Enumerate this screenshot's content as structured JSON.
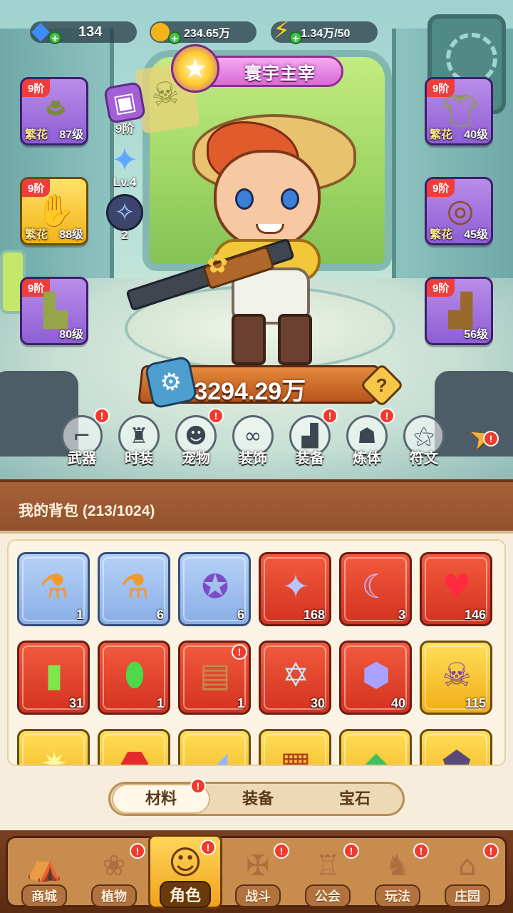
{
  "resources": {
    "gems": {
      "value": "134",
      "icon": "gem-icon"
    },
    "coins": {
      "value": "234.65万",
      "icon": "coin-icon"
    },
    "energy": {
      "value": "1.34万/50",
      "icon": "lightning-icon"
    }
  },
  "title_banner": {
    "text": "寰宇主宰"
  },
  "side_stats": {
    "rank": {
      "label": "9阶",
      "icon": "purple-box-icon"
    },
    "level": {
      "label": "Lv.4",
      "icon": "blue-star-icon"
    },
    "count": {
      "label": "2",
      "icon": "galaxy-orb-icon"
    }
  },
  "equipment": {
    "hat": {
      "rank": "9阶",
      "grade": "繁花",
      "level": "87级",
      "icon": "hat-icon"
    },
    "gloves": {
      "rank": "9阶",
      "grade": "繁花",
      "level": "88级",
      "icon": "gloves-icon"
    },
    "pants": {
      "rank": "9阶",
      "grade": "",
      "level": "80级",
      "icon": "shorts-icon"
    },
    "shirt": {
      "rank": "9阶",
      "grade": "繁花",
      "level": "40级",
      "icon": "shirt-icon"
    },
    "belt": {
      "rank": "9阶",
      "grade": "繁花",
      "level": "45级",
      "icon": "belt-icon"
    },
    "boots": {
      "rank": "9阶",
      "grade": "",
      "level": "56级",
      "icon": "boots-icon"
    }
  },
  "power": {
    "value": "3294.29万",
    "help": "?"
  },
  "functions": [
    {
      "label": "武器",
      "icon": "gun-icon",
      "alert": true
    },
    {
      "label": "时装",
      "icon": "outfit-icon",
      "alert": false
    },
    {
      "label": "宠物",
      "icon": "pet-icon",
      "alert": true
    },
    {
      "label": "装饰",
      "icon": "mask-icon",
      "alert": false
    },
    {
      "label": "装备",
      "icon": "boot-icon",
      "alert": true
    },
    {
      "label": "炼体",
      "icon": "muscle-icon",
      "alert": true
    },
    {
      "label": "符文",
      "icon": "rune-icon",
      "alert": false
    }
  ],
  "bag": {
    "title": "我的背包 (213/1024)",
    "items": [
      {
        "name": "syringe-orange",
        "count": "1",
        "rarity": "blue",
        "icon": "syringe-icon",
        "alert": false
      },
      {
        "name": "syringe-puzzle",
        "count": "6",
        "rarity": "blue",
        "icon": "syringe-icon",
        "alert": false
      },
      {
        "name": "compass-orb",
        "count": "6",
        "rarity": "blue",
        "icon": "compass-icon",
        "alert": false
      },
      {
        "name": "star-crystal",
        "count": "168",
        "rarity": "red",
        "icon": "star-crystal-icon",
        "alert": false
      },
      {
        "name": "moon-crystal",
        "count": "3",
        "rarity": "red",
        "icon": "moon-icon",
        "alert": false
      },
      {
        "name": "red-potion",
        "count": "146",
        "rarity": "red",
        "icon": "potion-icon",
        "alert": false
      },
      {
        "name": "green-canister",
        "count": "31",
        "rarity": "red",
        "icon": "canister-icon",
        "alert": false
      },
      {
        "name": "green-capsule",
        "count": "1",
        "rarity": "red",
        "icon": "capsule-icon",
        "alert": false
      },
      {
        "name": "supply-crate",
        "count": "1",
        "rarity": "red",
        "icon": "crate-icon",
        "alert": true
      },
      {
        "name": "hexagram-crystal",
        "count": "30",
        "rarity": "red",
        "icon": "hexagram-icon",
        "alert": false
      },
      {
        "name": "purple-cubes",
        "count": "40",
        "rarity": "red",
        "icon": "cubes-icon",
        "alert": false
      },
      {
        "name": "skull-scroll",
        "count": "115",
        "rarity": "gold",
        "icon": "skull-icon",
        "alert": false
      },
      {
        "name": "gold-item-1",
        "count": "",
        "rarity": "gold",
        "icon": "sparkle-icon",
        "alert": false
      },
      {
        "name": "gold-item-2",
        "count": "",
        "rarity": "gold",
        "icon": "ruby-icon",
        "alert": false
      },
      {
        "name": "gold-item-3",
        "count": "",
        "rarity": "gold",
        "icon": "shard-icon",
        "alert": false
      },
      {
        "name": "gold-item-4",
        "count": "",
        "rarity": "gold",
        "icon": "chest-icon",
        "alert": false
      },
      {
        "name": "gold-item-5",
        "count": "",
        "rarity": "gold",
        "icon": "emerald-icon",
        "alert": false
      },
      {
        "name": "gold-item-6",
        "count": "",
        "rarity": "gold",
        "icon": "rune-stone-icon",
        "alert": false
      }
    ]
  },
  "bag_tabs": [
    {
      "label": "材料",
      "active": true,
      "alert": true
    },
    {
      "label": "装备",
      "active": false,
      "alert": false
    },
    {
      "label": "宝石",
      "active": false,
      "alert": false
    }
  ],
  "nav": [
    {
      "label": "商城",
      "icon": "shop-icon",
      "active": false,
      "alert": false
    },
    {
      "label": "植物",
      "icon": "plant-icon",
      "active": false,
      "alert": true
    },
    {
      "label": "角色",
      "icon": "hero-icon",
      "active": true,
      "alert": true
    },
    {
      "label": "战斗",
      "icon": "battle-icon",
      "active": false,
      "alert": true
    },
    {
      "label": "公会",
      "icon": "guild-icon",
      "active": false,
      "alert": true
    },
    {
      "label": "玩法",
      "icon": "play-icon",
      "active": false,
      "alert": true
    },
    {
      "label": "庄园",
      "icon": "manor-icon",
      "active": false,
      "alert": true
    }
  ],
  "alert_mark": "!",
  "colors": {
    "alert": "#f03a2c",
    "accent": "#f2a21c",
    "panel": "#f7eddc"
  }
}
